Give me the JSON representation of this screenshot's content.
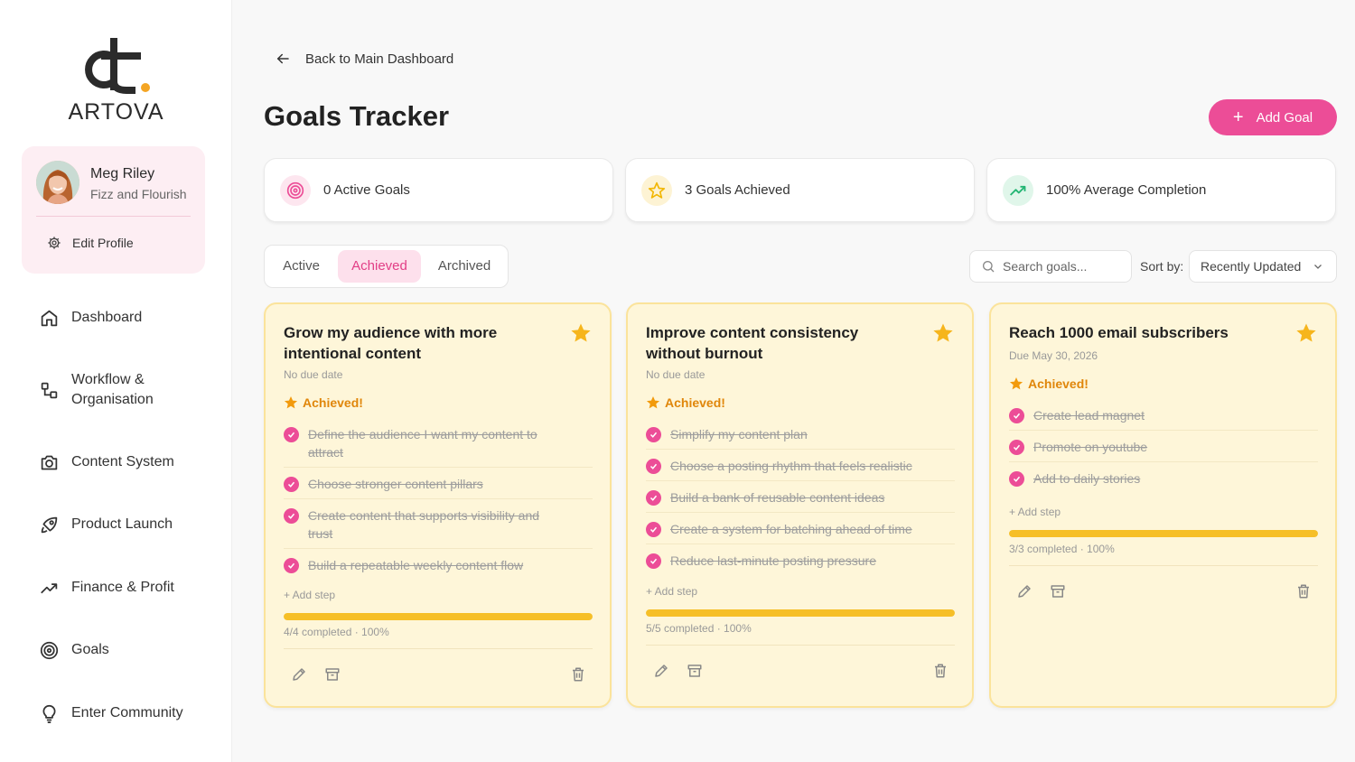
{
  "brand": {
    "name": "ARTOVA"
  },
  "profile": {
    "name": "Meg Riley",
    "business": "Fizz and Flourish",
    "edit_label": "Edit Profile"
  },
  "nav": [
    {
      "label": "Dashboard",
      "icon": "home-icon"
    },
    {
      "label": "Workflow & Organisation",
      "icon": "workflow-icon"
    },
    {
      "label": "Content System",
      "icon": "camera-icon"
    },
    {
      "label": "Product Launch",
      "icon": "rocket-icon"
    },
    {
      "label": "Finance & Profit",
      "icon": "trending-up-icon"
    },
    {
      "label": "Goals",
      "icon": "target-icon"
    },
    {
      "label": "Enter Community",
      "icon": "lightbulb-icon"
    }
  ],
  "header": {
    "back_label": "Back to Main Dashboard",
    "title": "Goals Tracker",
    "add_goal_label": "Add Goal"
  },
  "stats": [
    {
      "label": "0 Active Goals",
      "icon": "target-icon",
      "color": "#ec4d97"
    },
    {
      "label": "3 Goals Achieved",
      "icon": "star-outline-icon",
      "color": "#f2b705"
    },
    {
      "label": "100% Average Completion",
      "icon": "trending-up-icon",
      "color": "#22b573"
    }
  ],
  "tabs": [
    {
      "label": "Active",
      "active": false
    },
    {
      "label": "Achieved",
      "active": true
    },
    {
      "label": "Archived",
      "active": false
    }
  ],
  "search": {
    "placeholder": "Search goals..."
  },
  "sort": {
    "label": "Sort by:",
    "value": "Recently Updated"
  },
  "achieved_label": "Achieved!",
  "add_step_label": "+ Add step",
  "goals": [
    {
      "title": "Grow my audience with more intentional content",
      "due": "No due date",
      "steps": [
        "Define the audience I want my content to attract",
        "Choose stronger content pillars",
        "Create content that supports visibility and trust",
        "Build a repeatable weekly content flow"
      ],
      "progress_text": "4/4 completed · 100%",
      "progress": 1.0
    },
    {
      "title": "Improve content consistency without burnout",
      "due": "No due date",
      "steps": [
        "Simplify my content plan",
        "Choose a posting rhythm that feels realistic",
        "Build a bank of reusable content ideas",
        "Create a system for batching ahead of time",
        "Reduce last-minute posting pressure"
      ],
      "progress_text": "5/5 completed · 100%",
      "progress": 1.0
    },
    {
      "title": "Reach 1000 email subscribers",
      "due": "Due May 30, 2026",
      "steps": [
        "Create lead magnet",
        "Promote on youtube",
        "Add to daily stories"
      ],
      "progress_text": "3/3 completed · 100%",
      "progress": 1.0
    }
  ],
  "colors": {
    "accent_pink": "#ec4d97",
    "achieved_orange": "#e0860a",
    "progress_yellow": "#f6bf27",
    "card_bg": "#fef6d9"
  }
}
